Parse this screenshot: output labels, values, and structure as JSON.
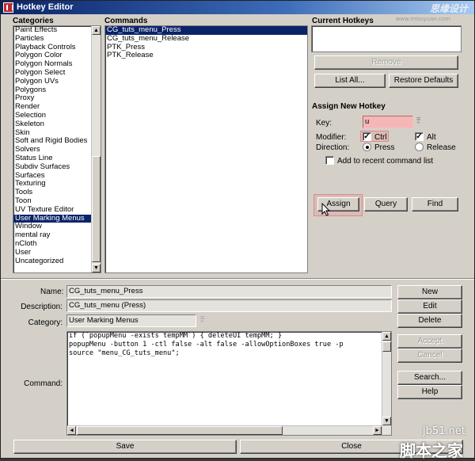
{
  "window": {
    "title": "Hotkey Editor",
    "watermark": "思缘设计",
    "watermark_url": "www.missyuan.com"
  },
  "categories": {
    "header": "Categories",
    "items": [
      "Paint Effects",
      "Particles",
      "Playback Controls",
      "Polygon Color",
      "Polygon Normals",
      "Polygon Select",
      "Polygon UVs",
      "Polygons",
      "Proxy",
      "Render",
      "Selection",
      "Skeleton",
      "Skin",
      "Soft and Rigid Bodies",
      "Solvers",
      "Status Line",
      "Subdiv Surfaces",
      "Surfaces",
      "Texturing",
      "Tools",
      "Toon",
      "UV Texture Editor",
      "User Marking Menus",
      "Window",
      "mental ray",
      "nCloth",
      "User",
      "Uncategorized"
    ],
    "selected": "User Marking Menus"
  },
  "commands": {
    "header": "Commands",
    "items": [
      "CG_tuts_menu_Press",
      "CG_tuts_menu_Release",
      "PTK_Press",
      "PTK_Release"
    ],
    "selected": "CG_tuts_menu_Press"
  },
  "current_hotkeys": {
    "header": "Current Hotkeys",
    "remove_label": "Remove",
    "list_all_label": "List All...",
    "restore_defaults_label": "Restore Defaults"
  },
  "assign": {
    "header": "Assign New Hotkey",
    "key_label": "Key:",
    "key_value": "u",
    "modifier_label": "Modifier:",
    "ctrl_label": "Ctrl",
    "ctrl_checked": true,
    "alt_label": "Alt",
    "alt_checked": true,
    "direction_label": "Direction:",
    "press_label": "Press",
    "release_label": "Release",
    "direction_selected": "Press",
    "recent_label": "Add to recent command list",
    "recent_checked": false,
    "assign_label": "Assign",
    "query_label": "Query",
    "find_label": "Find"
  },
  "editor": {
    "name_label": "Name:",
    "name_value": "CG_tuts_menu_Press",
    "description_label": "Description:",
    "description_value": "CG_tuts_menu (Press)",
    "category_label": "Category:",
    "category_value": "User Marking Menus",
    "command_label": "Command:",
    "command_lines": [
      "if (`popupMenu -exists tempMM`) { deleteUI tempMM; }",
      "popupMenu -button 1 -ctl false -alt false -allowOptionBoxes true -p",
      "source \"menu_CG_tuts_menu\";"
    ],
    "new_label": "New",
    "edit_label": "Edit",
    "delete_label": "Delete",
    "accept_label": "Accept",
    "cancel_label": "Cancel",
    "search_label": "Search...",
    "help_label": "Help"
  },
  "footer": {
    "save_label": "Save",
    "close_label": "Close",
    "site_watermark": "jb51.net",
    "site_watermark_cn": "脚本之家"
  },
  "colors": {
    "selection": "#0a246a",
    "key_field": "#f3b7b7",
    "highlight": "#e89696"
  }
}
